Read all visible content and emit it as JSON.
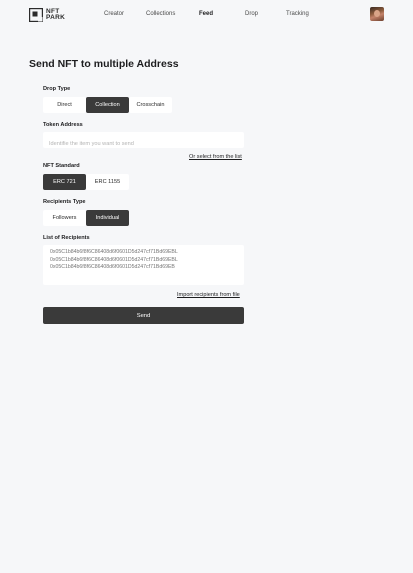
{
  "header": {
    "logo_line1": "NFT",
    "logo_line2": "PARK",
    "nav": [
      {
        "label": "Creator"
      },
      {
        "label": "Collections"
      },
      {
        "label": "Feed"
      },
      {
        "label": "Drop"
      },
      {
        "label": "Tracking"
      }
    ],
    "active_nav": "Feed"
  },
  "main": {
    "title": "Send NFT to multiple Address",
    "drop_type": {
      "label": "Drop Type",
      "options": [
        "Direct",
        "Collection",
        "Crosschain"
      ],
      "selected": "Collection"
    },
    "token_address": {
      "label": "Token Address",
      "value": "",
      "placeholder": "Identifie the item you want to send",
      "select_link": "Or select from the list"
    },
    "nft_standard": {
      "label": "NFT Standard",
      "options": [
        "ERC 721",
        "ERC 1155"
      ],
      "selected": "ERC 721"
    },
    "recipients_type": {
      "label": "Recipients Type",
      "options": [
        "Followers",
        "Individual"
      ],
      "selected": "Individual"
    },
    "recipients": {
      "label": "List of Recipients",
      "placeholder": "0x05C1b84b6f8f6C86408d6f0601D5d247cf71Bd69EBL\n0x05C1b84b6f8f6C86408d6f0601D5d247cf71Bd69EBL\n0x05C1b84b6f8f6C86408d6f0601D5d247cf71Bd69EB",
      "import_link": "Import recipients from file"
    },
    "send_label": "Send"
  },
  "colors": {
    "background": "#f6f7f9",
    "selected": "#3a3a3a",
    "surface": "#ffffff"
  }
}
